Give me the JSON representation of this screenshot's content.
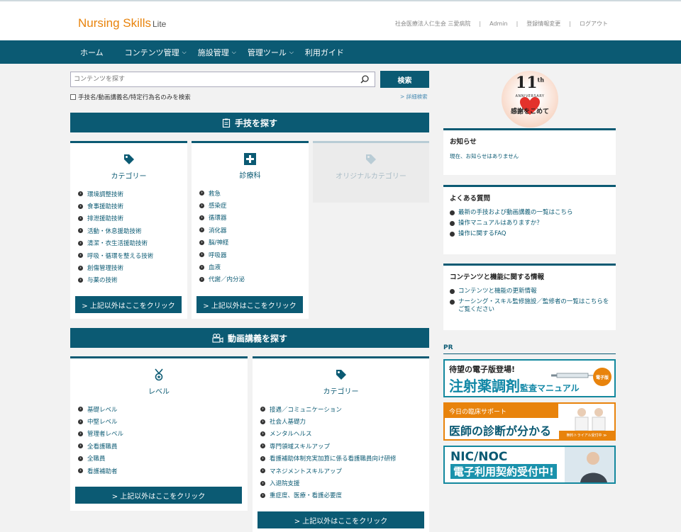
{
  "brand": {
    "name": "Nursing Skills",
    "edition": "Lite"
  },
  "top_links": {
    "org": "社会医療法人仁生会 三愛病院",
    "admin": "Admin",
    "profile": "登録情報変更",
    "logout": "ログアウト",
    "sep": "|"
  },
  "nav": [
    {
      "label": "ホーム",
      "dropdown": false
    },
    {
      "label": "コンテンツ管理",
      "dropdown": true
    },
    {
      "label": "施設管理",
      "dropdown": true
    },
    {
      "label": "管理ツール",
      "dropdown": true
    },
    {
      "label": "利用ガイド",
      "dropdown": false
    }
  ],
  "search": {
    "placeholder": "コンテンツを探す",
    "button": "検索",
    "checkbox_label": "手技名/動画講義名/特定行為名のみを検索",
    "advanced": "> 詳細検索"
  },
  "skills_section": {
    "title": "手技を探す",
    "category": {
      "title": "カテゴリー",
      "items": [
        "環境調整技術",
        "食事援助技術",
        "排泄援助技術",
        "活動・休息援助技術",
        "清潔・衣生活援助技術",
        "呼吸・循環を整える技術",
        "創傷管理技術",
        "与薬の技術"
      ],
      "more": "> 上記以外はここをクリック"
    },
    "department": {
      "title": "診療科",
      "items": [
        "救急",
        "感染症",
        "循環器",
        "消化器",
        "脳/神経",
        "呼吸器",
        "血液",
        "代謝／内分泌"
      ],
      "more": "> 上記以外はここをクリック"
    },
    "original": {
      "title": "オリジナルカテゴリー"
    }
  },
  "lectures_section": {
    "title": "動画講義を探す",
    "level": {
      "title": "レベル",
      "items": [
        "基礎レベル",
        "中堅レベル",
        "管理者レベル",
        "全看護職員",
        "全職員",
        "看護補助者"
      ],
      "more": "> 上記以外はここをクリック"
    },
    "category": {
      "title": "カテゴリー",
      "items": [
        "接遇／コミュニケーション",
        "社会人基礎力",
        "メンタルヘルス",
        "専門領域スキルアップ",
        "看護補助体制充実加算に係る看護職員向け研修",
        "マネジメントスキルアップ",
        "入退院支援",
        "重症度、医療・看護必要度"
      ],
      "more": "> 上記以外はここをクリック"
    }
  },
  "anniversary": {
    "number": "11",
    "suffix": "th",
    "caption": "ANNIVERSARY",
    "message": "感謝をこめて"
  },
  "news": {
    "title": "お知らせ",
    "empty": "現在、お知らせはありません"
  },
  "faq": {
    "title": "よくある質問",
    "items": [
      "最新の手技および動画講義の一覧はこちら",
      "操作マニュアルはありますか？",
      "操作に関するFAQ"
    ]
  },
  "info": {
    "title": "コンテンツと機能に関する情報",
    "items": [
      "コンテンツと機能の更新情報",
      "ナーシング・スキル監修施設／監修者の一覧はこちらをご覧ください"
    ]
  },
  "pr": {
    "label": "PR",
    "banner1": {
      "line1": "待望の電子版登場!",
      "line2_big": "注射薬調剤",
      "line2_small": "監査マニュアル",
      "badge": "電子版"
    },
    "banner2": {
      "line1": "今日の臨床サポート",
      "line2": "医師の診断が分かる",
      "trial": "無料トライアル受付中 ≫"
    },
    "banner3": {
      "line1": "NIC/NOC",
      "line2": "電子利用契約受付中!"
    }
  },
  "colors": {
    "primary": "#0b5a73",
    "accent": "#e8830c",
    "background": "#f2f2f2"
  }
}
